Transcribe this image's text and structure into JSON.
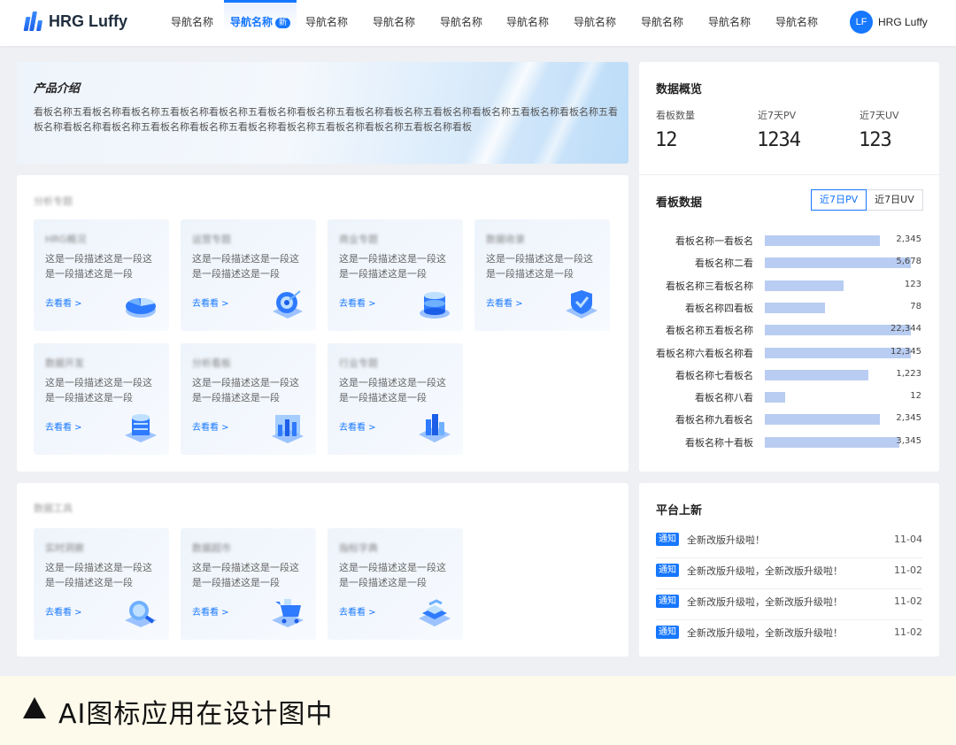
{
  "brand": {
    "name": "HRG Luffy"
  },
  "nav": {
    "items": [
      {
        "label": "导航名称"
      },
      {
        "label": "导航名称",
        "active": true,
        "badge": "新"
      },
      {
        "label": "导航名称"
      },
      {
        "label": "导航名称"
      },
      {
        "label": "导航名称"
      },
      {
        "label": "导航名称"
      },
      {
        "label": "导航名称"
      },
      {
        "label": "导航名称"
      },
      {
        "label": "导航名称"
      },
      {
        "label": "导航名称"
      }
    ]
  },
  "user": {
    "initials": "LF",
    "name": "HRG Luffy"
  },
  "intro": {
    "title": "产品介绍",
    "text": "看板名称五看板名称看板名称五看板名称看板名称五看板名称看板名称五看板名称看板名称五看板名称看板名称五看板名称看板名称五看板名称看板名称看板名称五看板名称看板名称五看板名称看板名称五看板名称看板名称五看板名称看板"
  },
  "section1": {
    "title": "分析专题",
    "cards": [
      {
        "title": "HRG概况",
        "desc": "这是一段描述这是一段这是一段描述这是一段",
        "link": "去看看 >",
        "icon": "pie-chart-3d-icon"
      },
      {
        "title": "运营专题",
        "desc": "这是一段描述这是一段这是一段描述这是一段",
        "link": "去看看 >",
        "icon": "target-3d-icon"
      },
      {
        "title": "商业专题",
        "desc": "这是一段描述这是一段这是一段描述这是一段",
        "link": "去看看 >",
        "icon": "database-3d-icon"
      },
      {
        "title": "数据收录",
        "desc": "这是一段描述这是一段这是一段描述这是一段",
        "link": "去看看 >",
        "icon": "shield-check-3d-icon"
      },
      {
        "title": "数据开发",
        "desc": "这是一段描述这是一段这是一段描述这是一段",
        "link": "去看看 >",
        "icon": "server-stack-3d-icon"
      },
      {
        "title": "分析看板",
        "desc": "这是一段描述这是一段这是一段描述这是一段",
        "link": "去看看 >",
        "icon": "bar-chart-3d-icon"
      },
      {
        "title": "行业专题",
        "desc": "这是一段描述这是一段这是一段描述这是一段",
        "link": "去看看 >",
        "icon": "city-3d-icon"
      }
    ]
  },
  "section2": {
    "title": "数据工具",
    "cards": [
      {
        "title": "实时洞察",
        "desc": "这是一段描述这是一段这是一段描述这是一段",
        "link": "去看看 >",
        "icon": "search-globe-3d-icon"
      },
      {
        "title": "数据超市",
        "desc": "这是一段描述这是一段这是一段描述这是一段",
        "link": "去看看 >",
        "icon": "shopping-cart-3d-icon"
      },
      {
        "title": "指标字典",
        "desc": "这是一段描述这是一段这是一段描述这是一段",
        "link": "去看看 >",
        "icon": "book-3d-icon"
      }
    ]
  },
  "overview": {
    "title": "数据概览",
    "stats": [
      {
        "label": "看板数量",
        "value": "12"
      },
      {
        "label": "近7天PV",
        "value": "1234"
      },
      {
        "label": "近7天UV",
        "value": "123"
      }
    ]
  },
  "board_data": {
    "title": "看板数据",
    "tabs": [
      {
        "label": "近7日PV",
        "active": true
      },
      {
        "label": "近7日UV",
        "active": false
      }
    ]
  },
  "chart_data": {
    "type": "bar",
    "orientation": "horizontal",
    "categories": [
      "看板名称一看板名",
      "看板名称二看",
      "看板名称三看板名称",
      "看板名称四看板",
      "看板名称五看板名称",
      "看板名称六看板名称看",
      "看板名称七看板名",
      "看板名称八看",
      "看板名称九看板名",
      "看板名称十看板"
    ],
    "values": [
      2345,
      5678,
      123,
      78,
      22344,
      12345,
      1223,
      12,
      2345,
      3345
    ],
    "value_labels": [
      "2,345",
      "5,678",
      "123",
      "78",
      "22,344",
      "12,345",
      "1,223",
      "12",
      "2,345",
      "3,345"
    ],
    "bar_fraction": [
      0.79,
      1.0,
      0.54,
      0.41,
      1.0,
      1.0,
      0.71,
      0.14,
      0.79,
      0.92
    ],
    "bar_color": "#b9cdf2"
  },
  "news": {
    "title": "平台上新",
    "items": [
      {
        "tag": "通知",
        "text": "全新改版升级啦！",
        "date": "11-04"
      },
      {
        "tag": "通知",
        "text": "全新改版升级啦，全新改版升级啦！",
        "date": "11-02"
      },
      {
        "tag": "通知",
        "text": "全新改版升级啦，全新改版升级啦！",
        "date": "11-02"
      },
      {
        "tag": "通知",
        "text": "全新改版升级啦，全新改版升级啦！",
        "date": "11-02"
      }
    ]
  },
  "caption": {
    "text": "AI图标应用在设计图中"
  },
  "colors": {
    "accent": "#1677ff",
    "bar": "#b9cdf2",
    "caption_bg": "#fdfaeb",
    "page_bg": "#eef0f4"
  }
}
